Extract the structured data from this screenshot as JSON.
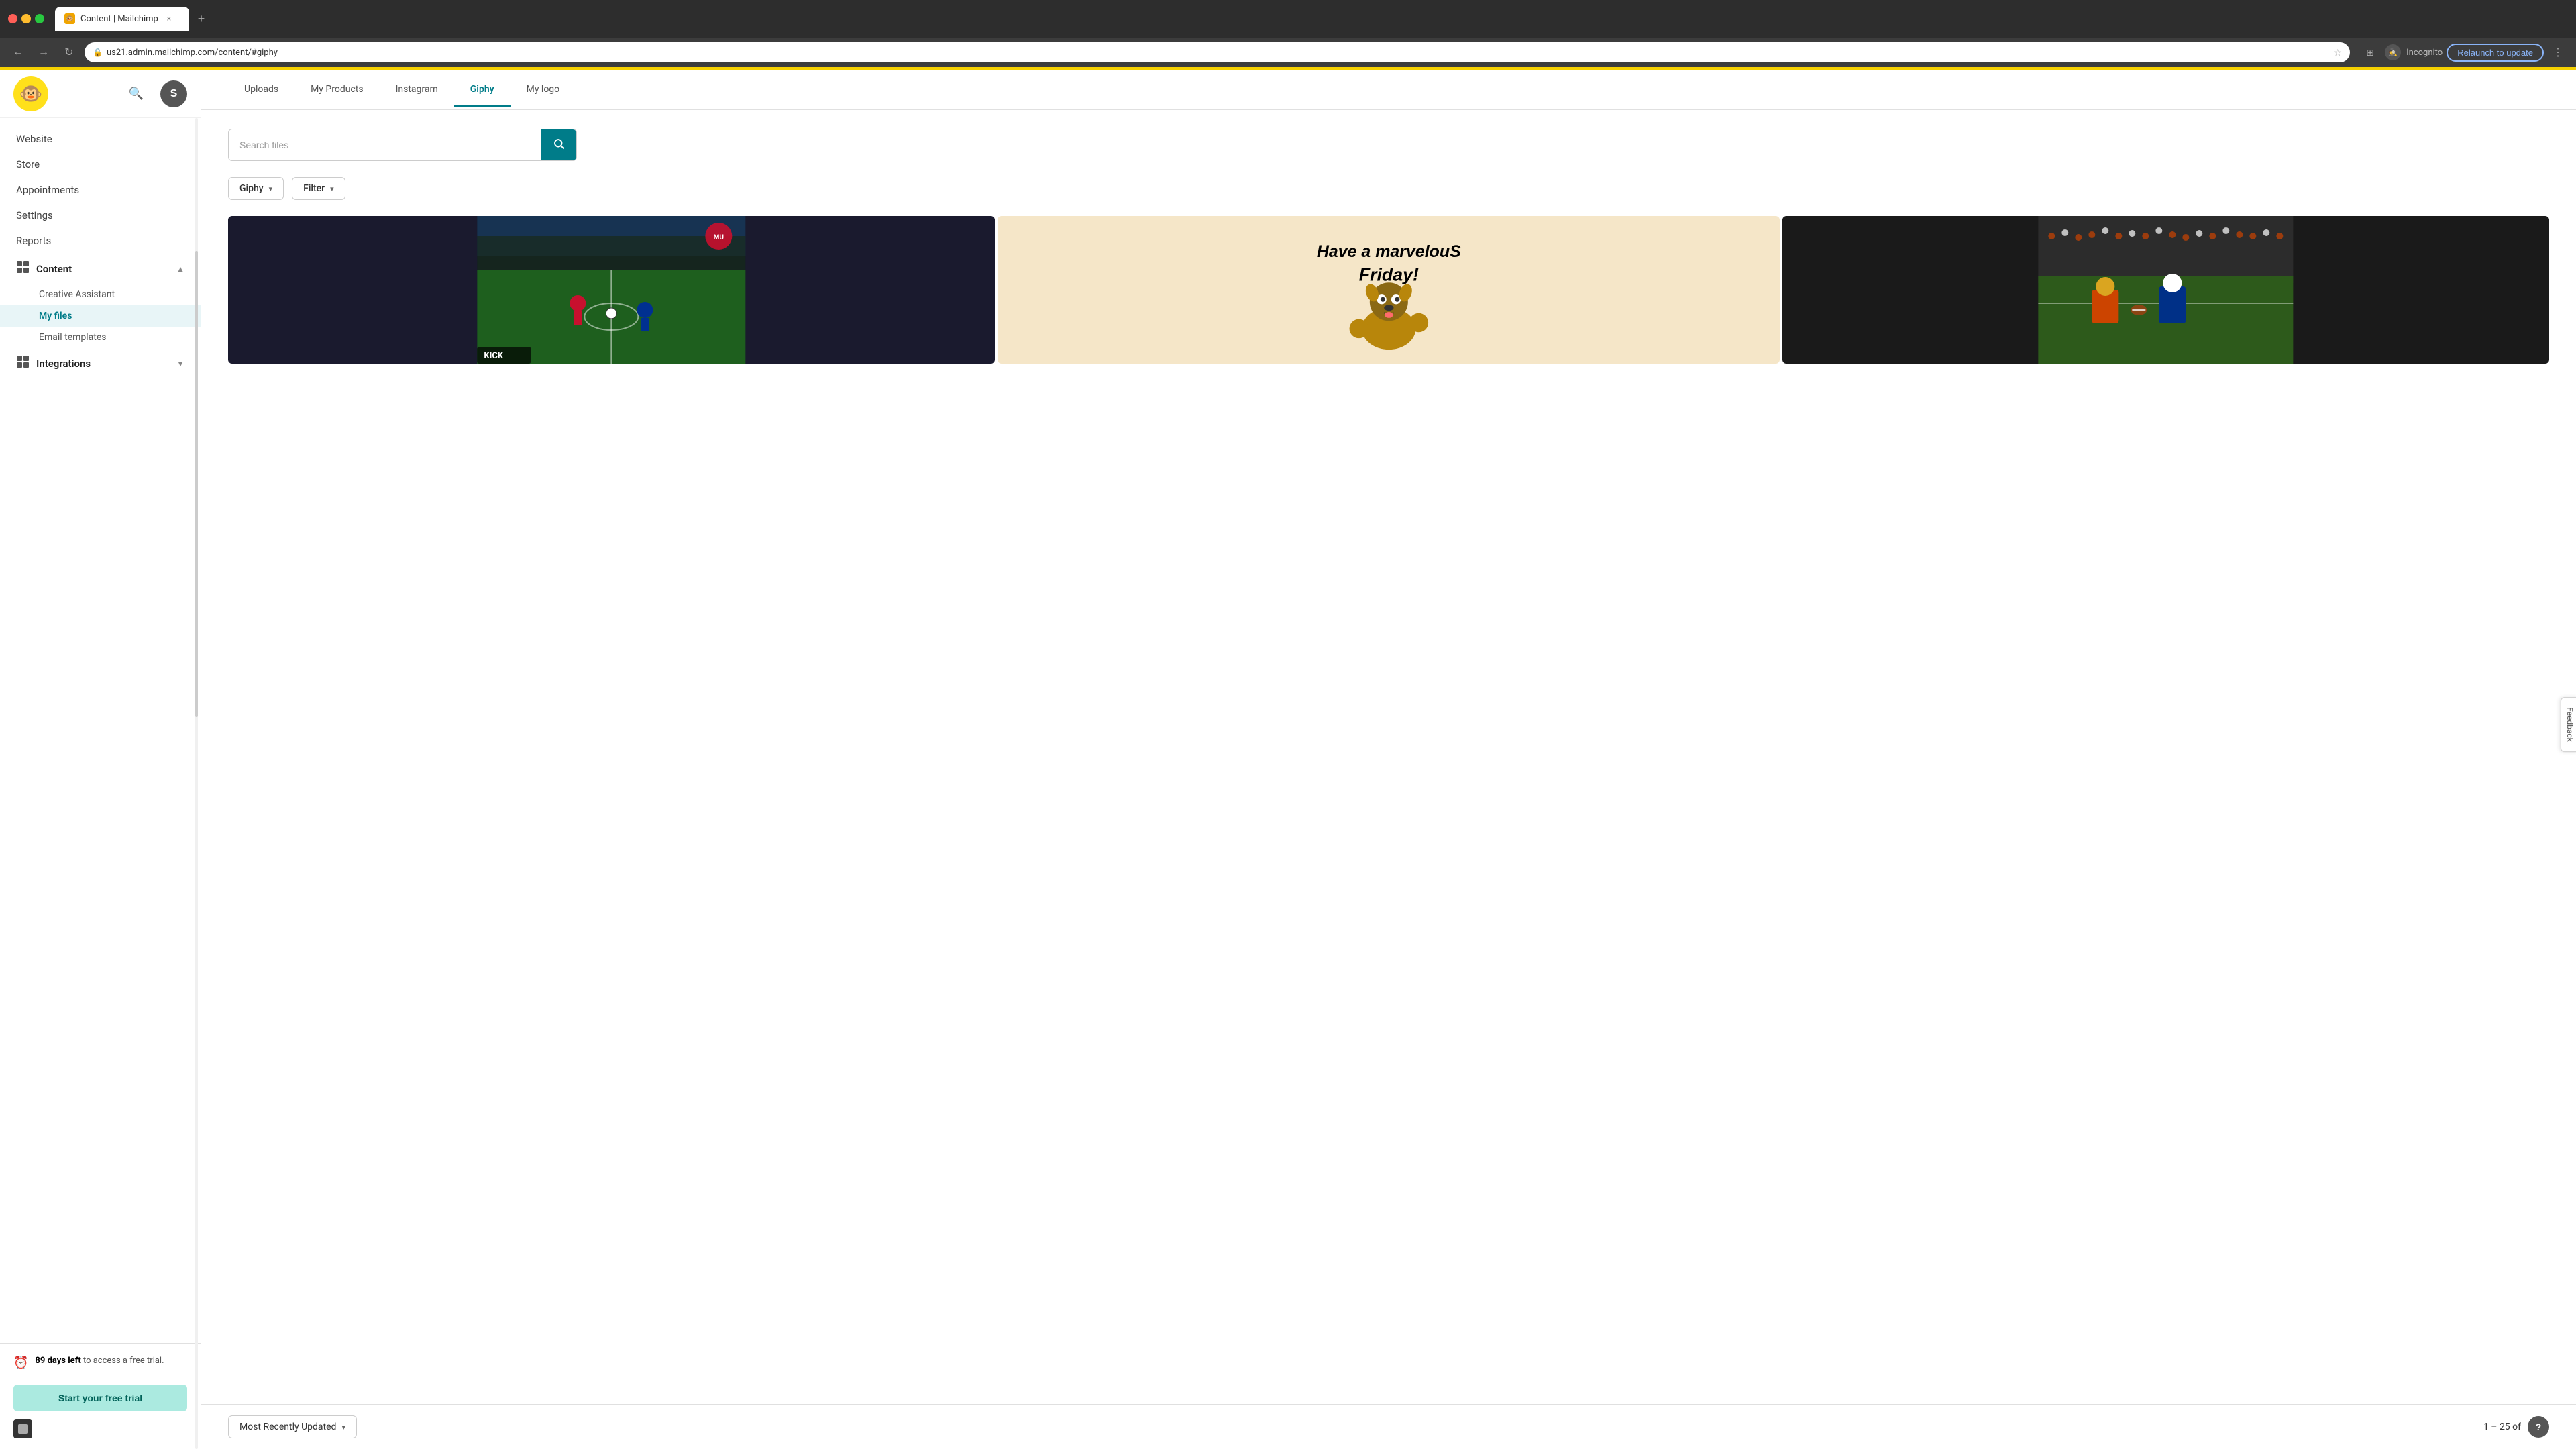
{
  "browser": {
    "tab_favicon": "🐵",
    "tab_title": "Content | Mailchimp",
    "tab_close": "×",
    "new_tab": "+",
    "nav_back": "←",
    "nav_forward": "→",
    "nav_refresh": "↻",
    "address": "us21.admin.mailchimp.com/content/#giphy",
    "lock_icon": "🔒",
    "bookmark_icon": "☆",
    "extensions_icon": "🧩",
    "sidebar_icon": "⊞",
    "incognito_label": "Incognito",
    "relaunch_label": "Relaunch to update",
    "minimize": "−",
    "maximize": "□",
    "close": "×"
  },
  "app": {
    "logo_emoji": "🐵",
    "search_icon": "🔍",
    "avatar_letter": "S"
  },
  "sidebar": {
    "items": [
      {
        "label": "Website",
        "icon": ""
      },
      {
        "label": "Store",
        "icon": ""
      },
      {
        "label": "Appointments",
        "icon": ""
      },
      {
        "label": "Settings",
        "icon": ""
      },
      {
        "label": "Reports",
        "icon": ""
      }
    ],
    "content_section": {
      "label": "Content",
      "icon": "⊞",
      "chevron": "▲",
      "children": [
        {
          "label": "Creative Assistant",
          "active": false
        },
        {
          "label": "My files",
          "active": true
        },
        {
          "label": "Email templates",
          "active": false
        }
      ]
    },
    "integrations_section": {
      "label": "Integrations",
      "icon": "⊞",
      "chevron": "▼"
    },
    "trial": {
      "days": "89 days left",
      "suffix": " to access a free trial.",
      "icon": "⏰",
      "button_label": "Start your free trial"
    }
  },
  "tabs": [
    {
      "label": "Uploads",
      "active": false
    },
    {
      "label": "My Products",
      "active": false
    },
    {
      "label": "Instagram",
      "active": false
    },
    {
      "label": "Giphy",
      "active": true
    },
    {
      "label": "My logo",
      "active": false
    }
  ],
  "search": {
    "placeholder": "Search files",
    "icon": "🔍"
  },
  "filters": [
    {
      "label": "Giphy",
      "arrow": "▾"
    },
    {
      "label": "Filter",
      "arrow": "▾"
    }
  ],
  "gifs": [
    {
      "id": "soccer",
      "label": "KICK",
      "type": "soccer"
    },
    {
      "id": "friday",
      "text_line1": "Have a marvelouS",
      "text_line2": "Friday!",
      "type": "friday"
    },
    {
      "id": "football",
      "type": "football"
    }
  ],
  "bottom": {
    "sort_label": "Most Recently Updated",
    "sort_arrow": "▾",
    "pagination": "1 – 25 of",
    "help": "?"
  },
  "feedback": {
    "label": "Feedback"
  }
}
